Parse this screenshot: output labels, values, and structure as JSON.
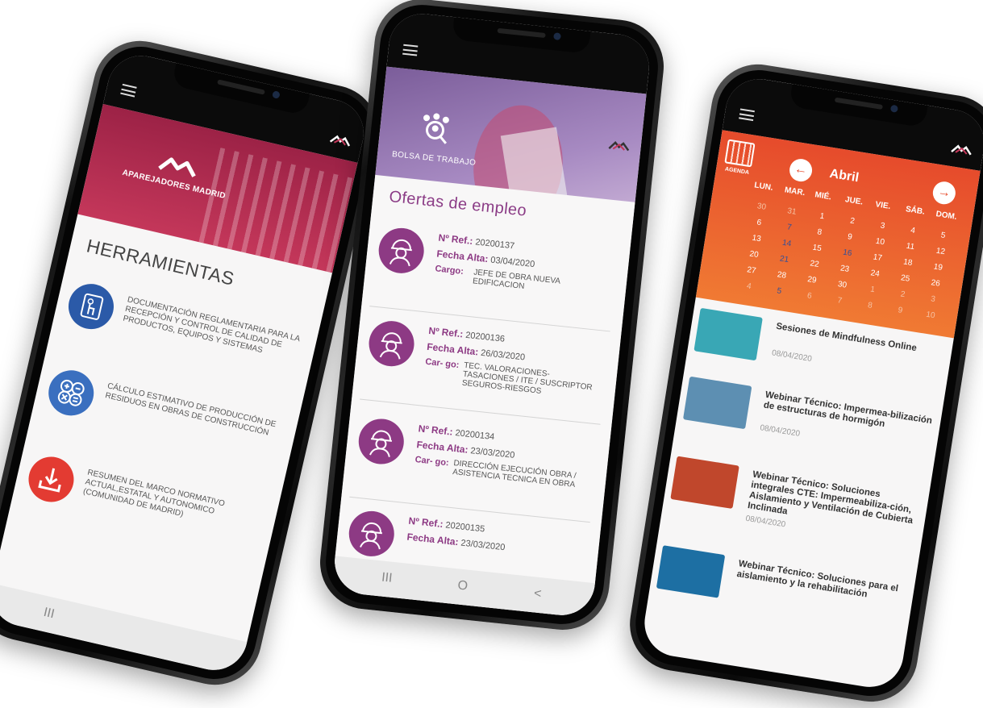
{
  "phone1": {
    "brand": "APAREJADORES MADRID",
    "title": "HERRAMIENTAS",
    "tools": [
      {
        "label": "DOCUMENTACIÓN REGLAMENTARIA PARA LA RECEPCIÓN Y CONTROL DE CALIDAD DE PRODUCTOS, EQUIPOS Y SISTEMAS",
        "icon": "touch-document-icon",
        "color": "#2b5aa8"
      },
      {
        "label": "CÁLCULO ESTIMATIVO DE PRODUCCIÓN DE RESIDUOS EN OBRAS DE CONSTRUCCIÓN",
        "icon": "calculator-icon",
        "color": "#3a6fbf"
      },
      {
        "label": "RESUMEN DEL MARCO NORMATIVO ACTUAL,ESTATAL Y AUTONOMICO (COMUNIDAD DE MADRID)",
        "icon": "download-icon",
        "color": "#e33b32"
      }
    ],
    "nav": "III"
  },
  "phone2": {
    "section": "BOLSA DE TRABAJO",
    "heading": "Ofertas de empleo",
    "labels": {
      "ref": "Nº Ref.:",
      "fecha": "Fecha Alta:",
      "cargo": "Cargo:",
      "cargo_split": "Car- go:"
    },
    "jobs": [
      {
        "ref": "20200137",
        "fecha": "03/04/2020",
        "cargo": "JEFE DE OBRA NUEVA EDIFICACION"
      },
      {
        "ref": "20200136",
        "fecha": "26/03/2020",
        "cargo": "TEC. VALORACIONES- TASACIONES / ITE / SUSCRIPTOR SEGUROS-RIESGOS"
      },
      {
        "ref": "20200134",
        "fecha": "23/03/2020",
        "cargo": "DIRECCIÓN EJECUCIÓN OBRA / ASISTENCIA TECNICA EN OBRA"
      },
      {
        "ref": "20200135",
        "fecha": "23/03/2020"
      }
    ],
    "nav": {
      "recent": "III",
      "home": "O",
      "back": "<"
    }
  },
  "phone3": {
    "agenda": "AGENDA",
    "month": "Abril",
    "prev": "←",
    "next": "→",
    "days": [
      "LUN.",
      "MAR.",
      "MIÉ.",
      "JUE.",
      "VIE.",
      "SÁB.",
      "DOM."
    ],
    "weeks": [
      [
        "30",
        "31",
        "1",
        "2",
        "3",
        "4",
        "5"
      ],
      [
        "6",
        "7",
        "8",
        "9",
        "10",
        "11",
        "12"
      ],
      [
        "13",
        "14",
        "15",
        "16",
        "17",
        "18",
        "19"
      ],
      [
        "20",
        "21",
        "22",
        "23",
        "24",
        "25",
        "26"
      ],
      [
        "27",
        "28",
        "29",
        "30",
        "1",
        "2",
        "3"
      ],
      [
        "4",
        "5",
        "6",
        "7",
        "8",
        "9",
        "10"
      ]
    ],
    "events": [
      {
        "title": "Sesiones de Mindfulness Online",
        "date": "08/04/2020",
        "thumb": "#39a7b5"
      },
      {
        "title": "Webinar Técnico: Impermea-bilización de estructuras de hormigón",
        "date": "08/04/2020",
        "thumb": "#5d8fb2"
      },
      {
        "title": "Webinar Técnico: Soluciones integrales CTE: Impermeabiliza-ción, Aislamiento y Ventilación de Cubierta Inclinada",
        "date": "08/04/2020",
        "thumb": "#c0472c"
      },
      {
        "title": "Webinar Técnico: Soluciones para el aislamiento y la rehabilitación",
        "date": "",
        "thumb": "#1d6fa3"
      }
    ]
  }
}
